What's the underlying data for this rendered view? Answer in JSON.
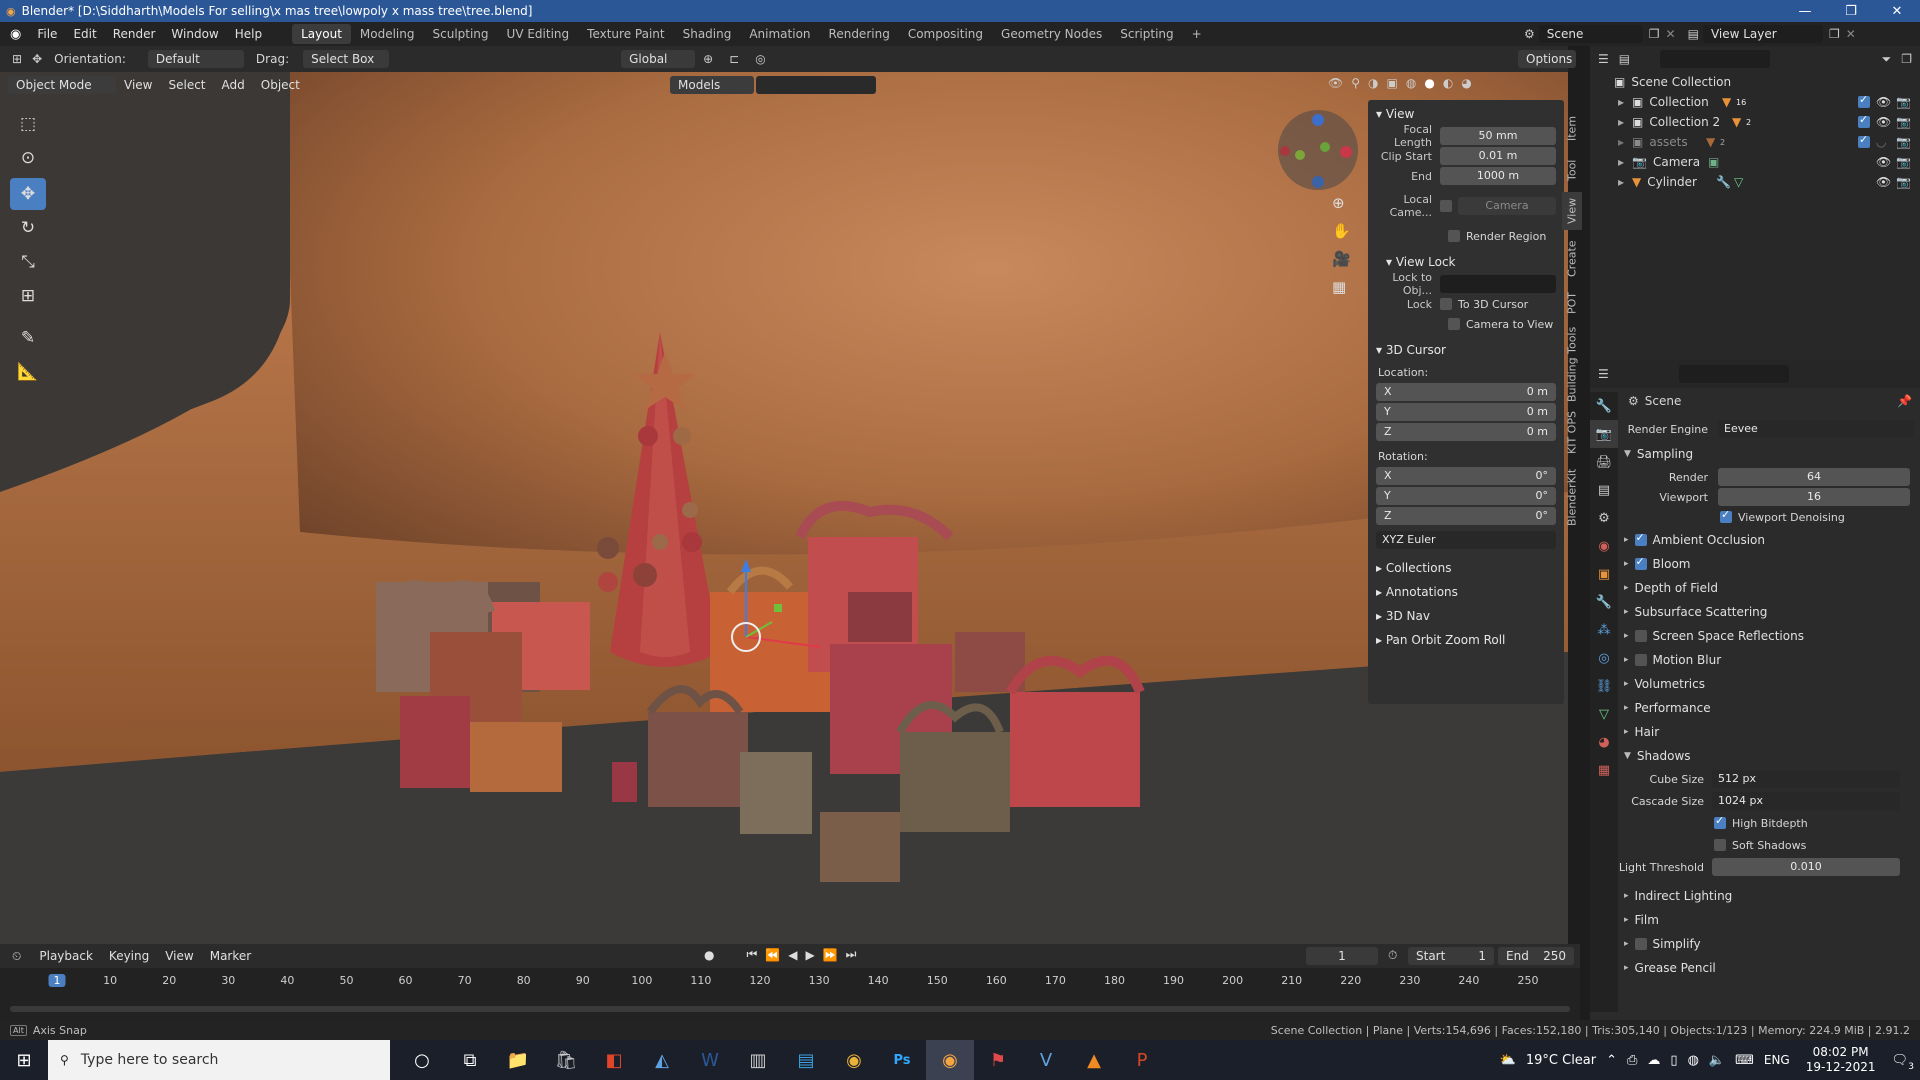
{
  "window": {
    "title": "Blender* [D:\\Siddharth\\Models For selling\\x mas tree\\lowpoly x mass tree\\tree.blend]",
    "minimize": "—",
    "maximize": "❐",
    "close": "✕"
  },
  "menu": [
    "File",
    "Edit",
    "Render",
    "Window",
    "Help"
  ],
  "workspaces": [
    "Layout",
    "Modeling",
    "Sculpting",
    "UV Editing",
    "Texture Paint",
    "Shading",
    "Animation",
    "Rendering",
    "Compositing",
    "Geometry Nodes",
    "Scripting"
  ],
  "active_workspace": "Layout",
  "scene_field": "Scene",
  "view_layer_field": "View Layer",
  "tool_header": {
    "orientation_label": "Orientation:",
    "orientation_value": "Default",
    "drag_label": "Drag:",
    "drag_value": "Select Box",
    "transform_value": "Global",
    "options": "Options"
  },
  "viewport_header": {
    "mode": "Object Mode",
    "menus": [
      "View",
      "Select",
      "Add",
      "Object"
    ],
    "models_field": "Models"
  },
  "npanel": {
    "view_title": "View",
    "focal_length_label": "Focal Length",
    "focal_length": "50 mm",
    "clip_start_label": "Clip Start",
    "clip_start": "0.01 m",
    "clip_end_label": "End",
    "clip_end": "1000 m",
    "local_camera_label": "Local Came...",
    "local_camera_value": "Camera",
    "render_region": "Render Region",
    "view_lock_title": "View Lock",
    "lock_to_obj_label": "Lock to Obj...",
    "lock_label": "Lock",
    "to_3d_cursor": "To 3D Cursor",
    "camera_to_view": "Camera to View",
    "cursor_title": "3D Cursor",
    "location_label": "Location:",
    "loc_x": "0 m",
    "loc_y": "0 m",
    "loc_z": "0 m",
    "rotation_label": "Rotation:",
    "rot_x": "0°",
    "rot_y": "0°",
    "rot_z": "0°",
    "x": "X",
    "y": "Y",
    "z": "Z",
    "rotation_mode": "XYZ Euler",
    "collections": "Collections",
    "annotations": "Annotations",
    "nav3d": "3D Nav",
    "pan_orbit": "Pan Orbit Zoom Roll"
  },
  "vertical_tabs": [
    "Item",
    "Tool",
    "View",
    "Create",
    "POT",
    "Building Tools",
    "KIT OPS",
    "BlenderKit"
  ],
  "outliner": {
    "root": "Scene Collection",
    "items": [
      {
        "name": "Collection",
        "badge": "16"
      },
      {
        "name": "Collection 2",
        "badge": "2"
      },
      {
        "name": "assets",
        "badge": "2"
      },
      {
        "name": "Camera",
        "badge": ""
      },
      {
        "name": "Cylinder",
        "badge": ""
      }
    ]
  },
  "properties": {
    "scene_title": "Scene",
    "render_engine_label": "Render Engine",
    "render_engine": "Eevee",
    "sampling": "Sampling",
    "render_label": "Render",
    "render_samples": "64",
    "viewport_label": "Viewport",
    "viewport_samples": "16",
    "viewport_denoising": "Viewport Denoising",
    "sections": [
      {
        "label": "Ambient Occlusion",
        "checkbox": true,
        "checked": true
      },
      {
        "label": "Bloom",
        "checkbox": true,
        "checked": true
      },
      {
        "label": "Depth of Field",
        "checkbox": false,
        "checked": false
      },
      {
        "label": "Subsurface Scattering",
        "checkbox": false,
        "checked": false
      },
      {
        "label": "Screen Space Reflections",
        "checkbox": true,
        "checked": false
      },
      {
        "label": "Motion Blur",
        "checkbox": true,
        "checked": false
      },
      {
        "label": "Volumetrics",
        "checkbox": false,
        "checked": false
      },
      {
        "label": "Performance",
        "checkbox": false,
        "checked": false
      },
      {
        "label": "Hair",
        "checkbox": false,
        "checked": false
      }
    ],
    "shadows": "Shadows",
    "cube_size_label": "Cube Size",
    "cube_size": "512 px",
    "cascade_size_label": "Cascade Size",
    "cascade_size": "1024 px",
    "high_bitdepth": "High Bitdepth",
    "soft_shadows": "Soft Shadows",
    "light_threshold_label": "Light Threshold",
    "light_threshold": "0.010",
    "after_sections": [
      {
        "label": "Indirect Lighting",
        "checkbox": false
      },
      {
        "label": "Film",
        "checkbox": false
      },
      {
        "label": "Simplify",
        "checkbox": true
      },
      {
        "label": "Grease Pencil",
        "checkbox": false
      }
    ]
  },
  "timeline": {
    "menus": [
      "Playback",
      "Keying",
      "View",
      "Marker"
    ],
    "current_frame": "1",
    "start_label": "Start",
    "start": "1",
    "end_label": "End",
    "end": "250",
    "ticks": [
      "1",
      "10",
      "20",
      "30",
      "40",
      "50",
      "60",
      "70",
      "80",
      "90",
      "100",
      "110",
      "120",
      "130",
      "140",
      "150",
      "160",
      "170",
      "180",
      "190",
      "200",
      "210",
      "220",
      "230",
      "240",
      "250"
    ]
  },
  "status": {
    "left": "Axis Snap",
    "right": "Scene Collection | Plane | Verts:154,696 | Faces:152,180 | Tris:305,140 | Objects:1/123 | Memory: 224.9 MiB | 2.91.2"
  },
  "taskbar": {
    "search_placeholder": "Type here to search",
    "weather": "19°C  Clear",
    "lang": "ENG",
    "time": "08:02 PM",
    "date": "19-12-2021",
    "notifications": "3"
  },
  "colors": {
    "accent": "#4a7fc1",
    "titlebar": "#2b5797",
    "viewport_bg": "#3d3a38",
    "floor": "#a86a3f"
  }
}
